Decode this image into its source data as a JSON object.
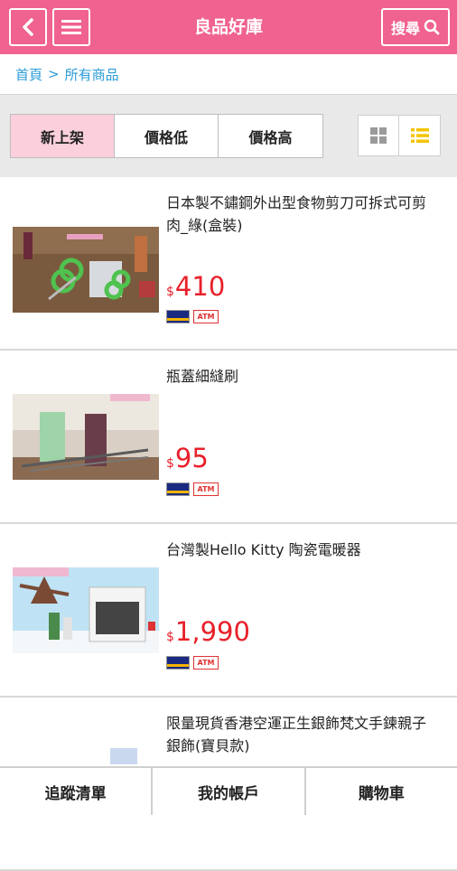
{
  "header": {
    "title": "良品好庫",
    "back_icon": "chevron-left-icon",
    "menu_icon": "hamburger-menu-icon",
    "search_label": "搜尋",
    "search_icon": "search-icon",
    "accent_color": "#f0628f"
  },
  "breadcrumb": {
    "home": "首頁",
    "separator": ">",
    "current": "所有商品"
  },
  "sort": {
    "newest": "新上架",
    "price_low": "價格低",
    "price_high": "價格高",
    "active": "新上架"
  },
  "view": {
    "grid_icon": "grid-view-icon",
    "list_icon": "list-view-icon",
    "active": "list"
  },
  "products": [
    {
      "name": "日本製不鏽鋼外出型食物剪刀可拆式可剪肉_綠(盒裝)",
      "currency": "$",
      "price": "410",
      "payments": [
        "VISA",
        "ATM"
      ]
    },
    {
      "name": "瓶蓋細縫刷",
      "currency": "$",
      "price": "95",
      "payments": [
        "VISA",
        "ATM"
      ]
    },
    {
      "name": "台灣製Hello Kitty 陶瓷電暖器",
      "currency": "$",
      "price": "1,990",
      "payments": [
        "VISA",
        "ATM"
      ]
    },
    {
      "name": "限量現貨香港空運正生銀飾梵文手鍊親子銀飾(寶貝款)",
      "currency": "",
      "price": "",
      "payments": []
    }
  ],
  "bottom_nav": {
    "track_list": "追蹤清單",
    "my_account": "我的帳戶",
    "cart": "購物車"
  },
  "colors": {
    "price": "#e8202a",
    "link": "#2a9bd8",
    "active_sort_bg": "#fbd0dc",
    "list_icon_active": "#f5c400"
  }
}
